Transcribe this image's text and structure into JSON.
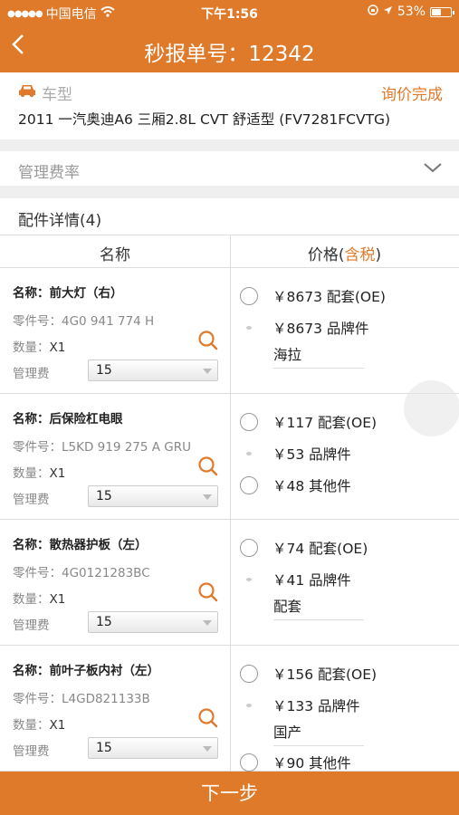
{
  "status_bar": {
    "carrier": "中国电信",
    "time": "下午1:56",
    "battery": "53%",
    "battery_level": 0.53
  },
  "header": {
    "back_icon": "back-chevron-icon",
    "title": "秒报单号：12342"
  },
  "vehicle": {
    "icon": "car-icon",
    "label": "车型",
    "status": "询价完成",
    "model": "2011 一汽奥迪A6 三厢2.8L CVT 舒适型 (FV7281FCVTG)"
  },
  "management_rate": {
    "label": "管理费率",
    "icon": "chevron-down-icon"
  },
  "parts_section": {
    "title": "配件详情(4)",
    "col_name": "名称",
    "col_price_prefix": "价格(",
    "col_price_accent": "含税",
    "col_price_suffix": ")"
  },
  "labels": {
    "name": "名称：",
    "part_no": "零件号：",
    "qty": "数量：",
    "fee": "管理费"
  },
  "parts": [
    {
      "name": "前大灯（右）",
      "part_no": "4G0 941 774 H",
      "qty": "X1",
      "fee": "15",
      "options": [
        {
          "price": "￥8673 配套(OE)",
          "control": "radio"
        },
        {
          "price": "￥8673 品牌件",
          "control": "dot",
          "brand": "海拉"
        }
      ]
    },
    {
      "name": "后保险杠电眼",
      "part_no": "L5KD 919 275 A GRU",
      "qty": "X1",
      "fee": "15",
      "options": [
        {
          "price": "￥117 配套(OE)",
          "control": "radio"
        },
        {
          "price": "￥53 品牌件",
          "control": "dot"
        },
        {
          "price": "￥48 其他件",
          "control": "radio"
        }
      ]
    },
    {
      "name": "散热器护板（左）",
      "part_no": "4G0121283BC",
      "qty": "X1",
      "fee": "15",
      "options": [
        {
          "price": "￥74 配套(OE)",
          "control": "radio"
        },
        {
          "price": "￥41 品牌件",
          "control": "dot",
          "brand": "配套"
        }
      ]
    },
    {
      "name": "前叶子板内衬（左）",
      "part_no": "L4GD821133B",
      "qty": "X1",
      "fee": "15",
      "options": [
        {
          "price": "￥156 配套(OE)",
          "control": "radio"
        },
        {
          "price": "￥133 品牌件",
          "control": "dot",
          "brand": "国产"
        },
        {
          "price": "￥90 其他件",
          "control": "radio"
        }
      ]
    }
  ],
  "footer": {
    "next_label": "下一步"
  },
  "colors": {
    "accent": "#e07a2b",
    "background": "#efefef"
  }
}
